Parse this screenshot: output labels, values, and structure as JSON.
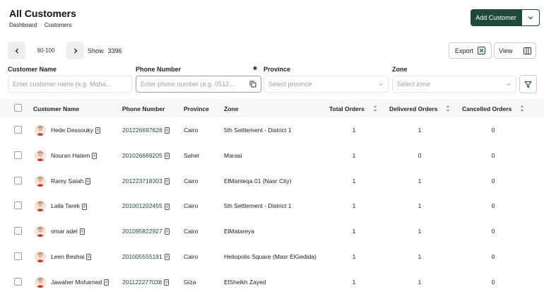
{
  "header": {
    "title": "All Customers",
    "breadcrumb": [
      "Dashboard",
      "Customers"
    ],
    "add_button": "Add Customer"
  },
  "pager": {
    "range": "90-100",
    "show_label": "Show",
    "total": "3396"
  },
  "toolbar": {
    "export_label": "Export",
    "view_label": "View"
  },
  "filters": {
    "customer_name": {
      "label": "Customer Name",
      "placeholder": "Enter customer name (e.g. Moha..."
    },
    "phone_number": {
      "label": "Phone Number",
      "placeholder": "Enter phone number (e.g. 0512..."
    },
    "province": {
      "label": "Province",
      "placeholder": "Select province"
    },
    "zone": {
      "label": "Zone",
      "placeholder": "Select zone"
    }
  },
  "table": {
    "columns": [
      "Customer Name",
      "Phone Number",
      "Province",
      "Zone",
      "Total Orders",
      "Delivered Orders",
      "Cancelled Orders"
    ],
    "rows": [
      {
        "name": "Hede Dessouky",
        "phone": "201226697628",
        "province": "Cairo",
        "zone": "5th Settlement - District 1",
        "total": "1",
        "delivered": "1",
        "cancelled": "0"
      },
      {
        "name": "Nouran Hatem",
        "phone": "201026669205",
        "province": "Sahel",
        "zone": "Marasi",
        "total": "1",
        "delivered": "0",
        "cancelled": "0"
      },
      {
        "name": "Ramy Salah",
        "phone": "201223718303",
        "province": "Cairo",
        "zone": "ElManteqa 01 (Nasr City)",
        "total": "1",
        "delivered": "1",
        "cancelled": "0"
      },
      {
        "name": "Laila Tarek",
        "phone": "201001202455",
        "province": "Cairo",
        "zone": "5th Settlement - District 1",
        "total": "1",
        "delivered": "1",
        "cancelled": "0"
      },
      {
        "name": "omar adel",
        "phone": "201095822927",
        "province": "Cairo",
        "zone": "ElMatareya",
        "total": "1",
        "delivered": "1",
        "cancelled": "0"
      },
      {
        "name": "Leen Beshai",
        "phone": "201005555191",
        "province": "Cairo",
        "zone": "Heliopolis Square (Masr ElGedida)",
        "total": "1",
        "delivered": "1",
        "cancelled": "0"
      },
      {
        "name": "Jawaher Mohamed",
        "phone": "201122277038",
        "province": "Giza",
        "zone": "ElSheikh Zayed",
        "total": "1",
        "delivered": "1",
        "cancelled": "0"
      }
    ]
  },
  "colors": {
    "brand": "#1f4a3b",
    "phone_link": "#1f4a3b",
    "header_bg": "#f7f7f8"
  }
}
